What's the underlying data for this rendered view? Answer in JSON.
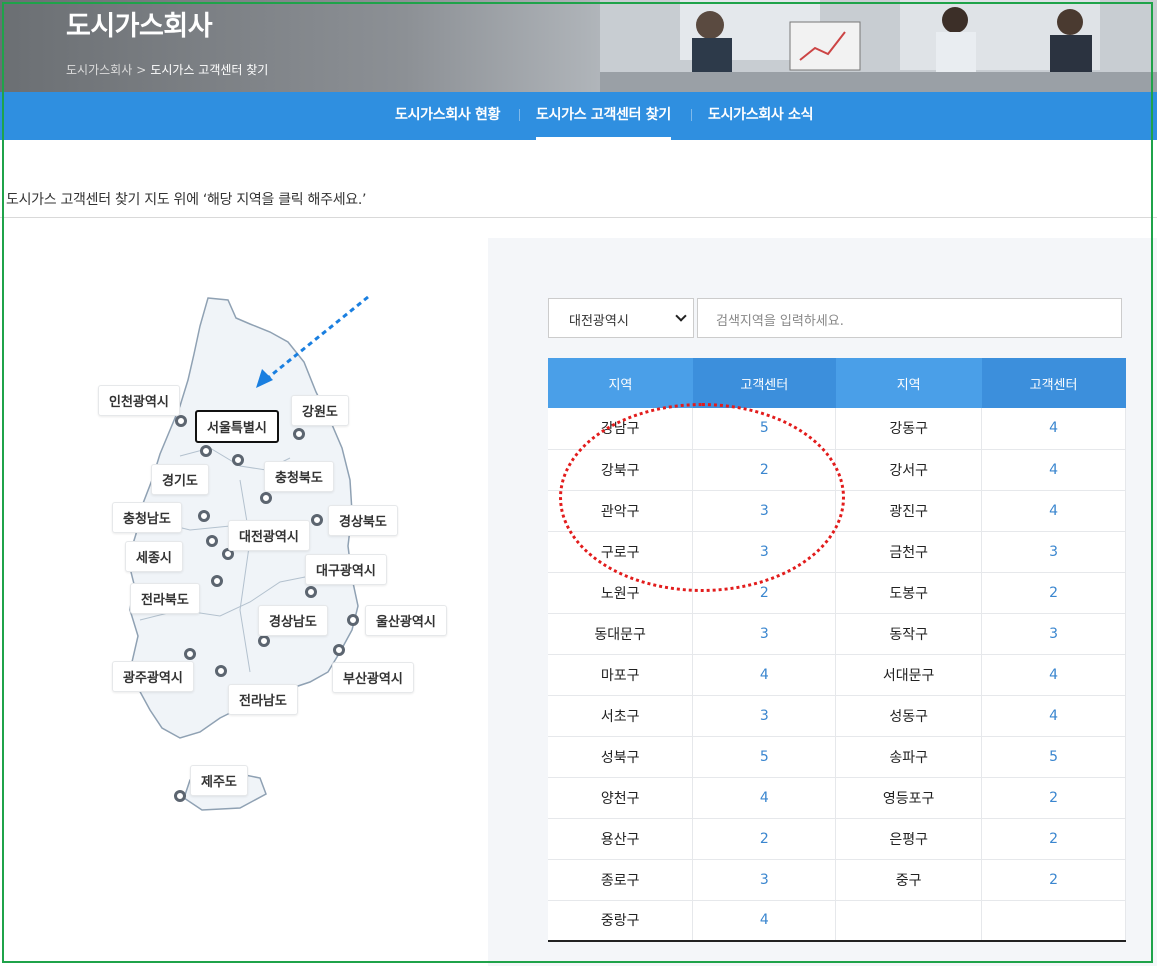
{
  "header": {
    "title": "도시가스회사",
    "breadcrumb": [
      "도시가스회사",
      "도시가스 고객센터 찾기"
    ]
  },
  "nav": {
    "tabs": [
      {
        "label": "도시가스회사 현황",
        "active": false
      },
      {
        "label": "도시가스 고객센터 찾기",
        "active": true
      },
      {
        "label": "도시가스회사 소식",
        "active": false
      }
    ]
  },
  "instruction": "도시가스 고객센터 찾기 지도 위에 ‘해당 지역을 클릭 해주세요.’",
  "map": {
    "regions": [
      "인천광역시",
      "서울특별시",
      "강원도",
      "경기도",
      "충청북도",
      "충청남도",
      "대전광역시",
      "경상북도",
      "세종시",
      "대구광역시",
      "전라북도",
      "경상남도",
      "울산광역시",
      "광주광역시",
      "부산광역시",
      "전라남도",
      "제주도"
    ],
    "selected": "서울특별시"
  },
  "filters": {
    "select_value": "대전광역시",
    "search_placeholder": "검색지역을 입력하세요."
  },
  "table": {
    "headers": [
      "지역",
      "고객센터",
      "지역",
      "고객센터"
    ],
    "rows": [
      [
        "강남구",
        "5",
        "강동구",
        "4"
      ],
      [
        "강북구",
        "2",
        "강서구",
        "4"
      ],
      [
        "관악구",
        "3",
        "광진구",
        "4"
      ],
      [
        "구로구",
        "3",
        "금천구",
        "3"
      ],
      [
        "노원구",
        "2",
        "도봉구",
        "2"
      ],
      [
        "동대문구",
        "3",
        "동작구",
        "3"
      ],
      [
        "마포구",
        "4",
        "서대문구",
        "4"
      ],
      [
        "서초구",
        "3",
        "성동구",
        "4"
      ],
      [
        "성북구",
        "5",
        "송파구",
        "5"
      ],
      [
        "양천구",
        "4",
        "영등포구",
        "2"
      ],
      [
        "용산구",
        "2",
        "은평구",
        "2"
      ],
      [
        "종로구",
        "3",
        "중구",
        "2"
      ],
      [
        "중랑구",
        "4",
        "",
        ""
      ]
    ]
  },
  "colors": {
    "nav_blue": "#2f8fe0",
    "header_blue": "#4a9fe8",
    "count_blue": "#3a86cf",
    "annotation_red": "#e21c1c",
    "frame_green": "#1fa34a"
  }
}
